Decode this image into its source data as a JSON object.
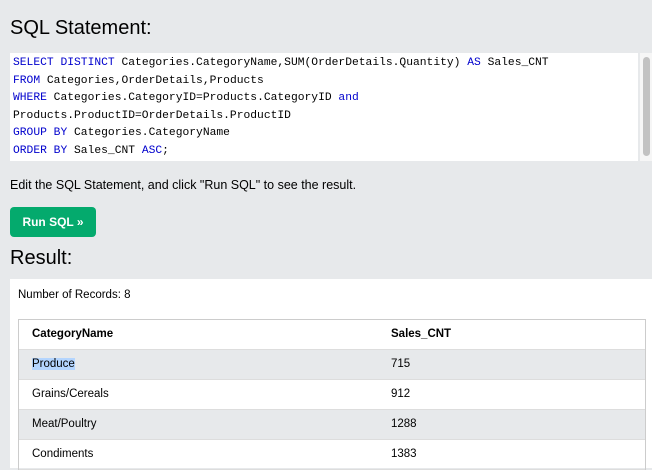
{
  "sql_heading": "SQL Statement:",
  "editor": {
    "lines": [
      [
        {
          "t": "SELECT DISTINCT",
          "k": true
        },
        {
          "t": " Categories.CategoryName,SUM(OrderDetails.Quantity) ",
          "k": false
        },
        {
          "t": "AS",
          "k": true
        },
        {
          "t": " Sales_CNT",
          "k": false
        }
      ],
      [
        {
          "t": "FROM",
          "k": true
        },
        {
          "t": " Categories,OrderDetails,Products",
          "k": false
        }
      ],
      [
        {
          "t": "WHERE",
          "k": true
        },
        {
          "t": " Categories.CategoryID=Products.CategoryID ",
          "k": false
        },
        {
          "t": "and",
          "k": true
        }
      ],
      [
        {
          "t": "Products.ProductID=OrderDetails.ProductID",
          "k": false
        }
      ],
      [
        {
          "t": "GROUP BY",
          "k": true
        },
        {
          "t": " Categories.CategoryName",
          "k": false
        }
      ],
      [
        {
          "t": "ORDER BY",
          "k": true
        },
        {
          "t": " Sales_CNT ",
          "k": false
        },
        {
          "t": "ASC",
          "k": true
        },
        {
          "t": ";",
          "k": false
        }
      ]
    ]
  },
  "instructions": "Edit the SQL Statement, and click \"Run SQL\" to see the result.",
  "run_button": "Run SQL »",
  "result_heading": "Result:",
  "records_text": "Number of Records: 8",
  "table": {
    "headers": [
      "CategoryName",
      "Sales_CNT"
    ],
    "rows": [
      [
        "Produce",
        "715"
      ],
      [
        "Grains/Cereals",
        "912"
      ],
      [
        "Meat/Poultry",
        "1288"
      ],
      [
        "Condiments",
        "1383"
      ]
    ],
    "selected_text": "Produce"
  }
}
